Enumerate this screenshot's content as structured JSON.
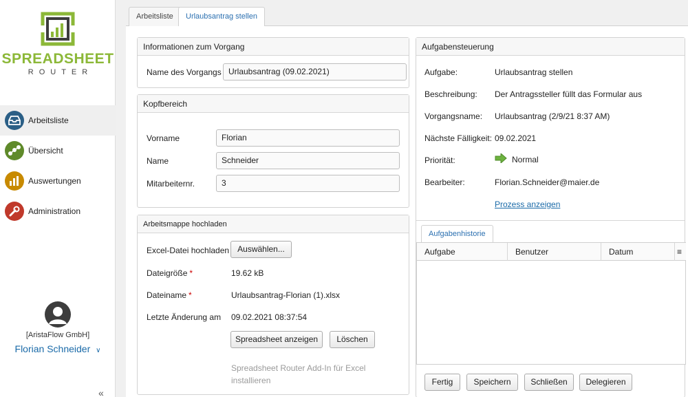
{
  "logo": {
    "title": "SPREADSHEET",
    "subtitle": "ROUTER"
  },
  "nav": {
    "items": [
      {
        "label": "Arbeitsliste",
        "color": "#2b5f86",
        "icon": "inbox-tray-icon"
      },
      {
        "label": "Übersicht",
        "color": "#5f8a2a",
        "icon": "process-chain-icon"
      },
      {
        "label": "Auswertungen",
        "color": "#c88a00",
        "icon": "bar-chart-icon"
      },
      {
        "label": "Administration",
        "color": "#c0392b",
        "icon": "wrench-icon"
      }
    ]
  },
  "user": {
    "company": "[AristaFlow GmbH]",
    "name": "Florian Schneider"
  },
  "tabs": [
    "Arbeitsliste",
    "Urlaubsantrag stellen"
  ],
  "info": {
    "title": "Informationen zum Vorgang",
    "name_label": "Name des Vorgangs",
    "name_value": "Urlaubsantrag  (09.02.2021)"
  },
  "kopf": {
    "title": "Kopfbereich",
    "vorname_label": "Vorname",
    "vorname_value": "Florian",
    "name_label": "Name",
    "name_value": "Schneider",
    "mitarbeiter_label": "Mitarbeiternr.",
    "mitarbeiter_value": "3"
  },
  "upload": {
    "title": "Arbeitsmappe hochladen",
    "excel_label": "Excel-Datei hochladen",
    "choose_button": "Auswählen...",
    "size_label": "Dateigröße",
    "size_value": "19.62 kB",
    "filename_label": "Dateiname",
    "filename_value": "Urlaubsantrag-Florian (1).xlsx",
    "changed_label": "Letzte Änderung am",
    "changed_value": "09.02.2021 08:37:54",
    "show_button": "Spreadsheet anzeigen",
    "delete_button": "Löschen",
    "addin_text_1": "Spreadsheet Router Add-In für Excel",
    "addin_text_2": "installieren"
  },
  "task": {
    "title": "Aufgabensteuerung",
    "aufgabe_label": "Aufgabe:",
    "aufgabe_value": "Urlaubsantrag stellen",
    "beschreibung_label": "Beschreibung:",
    "beschreibung_value": "Der Antragssteller füllt das Formular aus",
    "vorgangsname_label": "Vorgangsname:",
    "vorgangsname_value": "Urlaubsantrag (2/9/21 8:37 AM)",
    "faelligkeit_label": "Nächste Fälligkeit:",
    "faelligkeit_value": "09.02.2021",
    "prioritaet_label": "Priorität:",
    "prioritaet_value": "Normal",
    "bearbeiter_label": "Bearbeiter:",
    "bearbeiter_value": "Florian.Schneider@maier.de",
    "process_link": "Prozess anzeigen"
  },
  "history": {
    "tab": "Aufgabenhistorie",
    "columns": [
      "Aufgabe",
      "Benutzer",
      "Datum"
    ]
  },
  "actions": {
    "fertig": "Fertig",
    "speichern": "Speichern",
    "schliessen": "Schließen",
    "delegieren": "Delegieren"
  },
  "colors": {
    "accent": "#1a6aa8",
    "logo_green": "#8cb838",
    "priority_arrow": "#6db33f"
  }
}
